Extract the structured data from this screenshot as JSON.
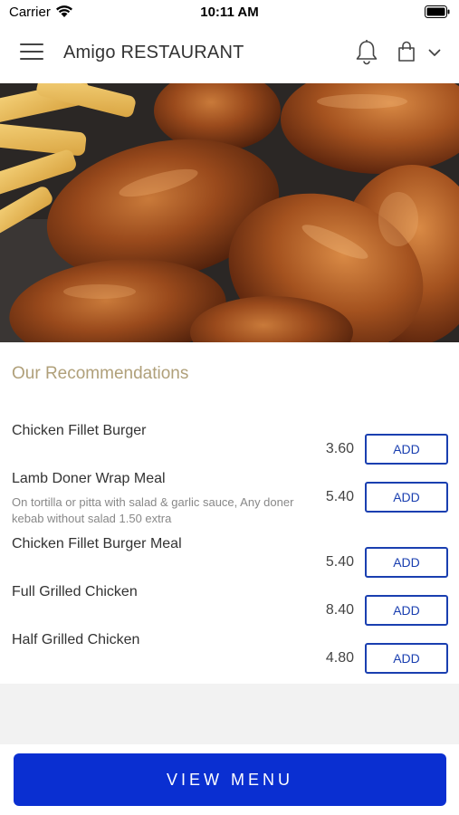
{
  "status_bar": {
    "carrier": "Carrier",
    "time": "10:11 AM"
  },
  "header": {
    "title": "Amigo RESTAURANT",
    "icons": [
      "menu-icon",
      "bell-icon",
      "bag-icon",
      "chevron-down-icon"
    ]
  },
  "hero": {
    "image": "chicken-wings-photo"
  },
  "recommendations": {
    "title": "Our Recommendations",
    "items": [
      {
        "name": "Chicken Fillet Burger",
        "description": "",
        "price": "3.60",
        "add_label": "ADD"
      },
      {
        "name": "Lamb Doner Wrap Meal",
        "description": "On tortilla or pitta with salad & garlic sauce,   Any doner kebab without salad 1.50 extra",
        "price": "5.40",
        "add_label": "ADD"
      },
      {
        "name": "Chicken Fillet Burger Meal",
        "description": "",
        "price": "5.40",
        "add_label": "ADD"
      },
      {
        "name": "Full Grilled Chicken",
        "description": "",
        "price": "8.40",
        "add_label": "ADD"
      },
      {
        "name": "Half Grilled Chicken",
        "description": "",
        "price": "4.80",
        "add_label": "ADD"
      }
    ]
  },
  "footer": {
    "view_menu_label": "VIEW MENU"
  },
  "colors": {
    "accent": "#0a2fd1",
    "add_border": "#1a3fb0",
    "section_title": "#b0a07a"
  }
}
